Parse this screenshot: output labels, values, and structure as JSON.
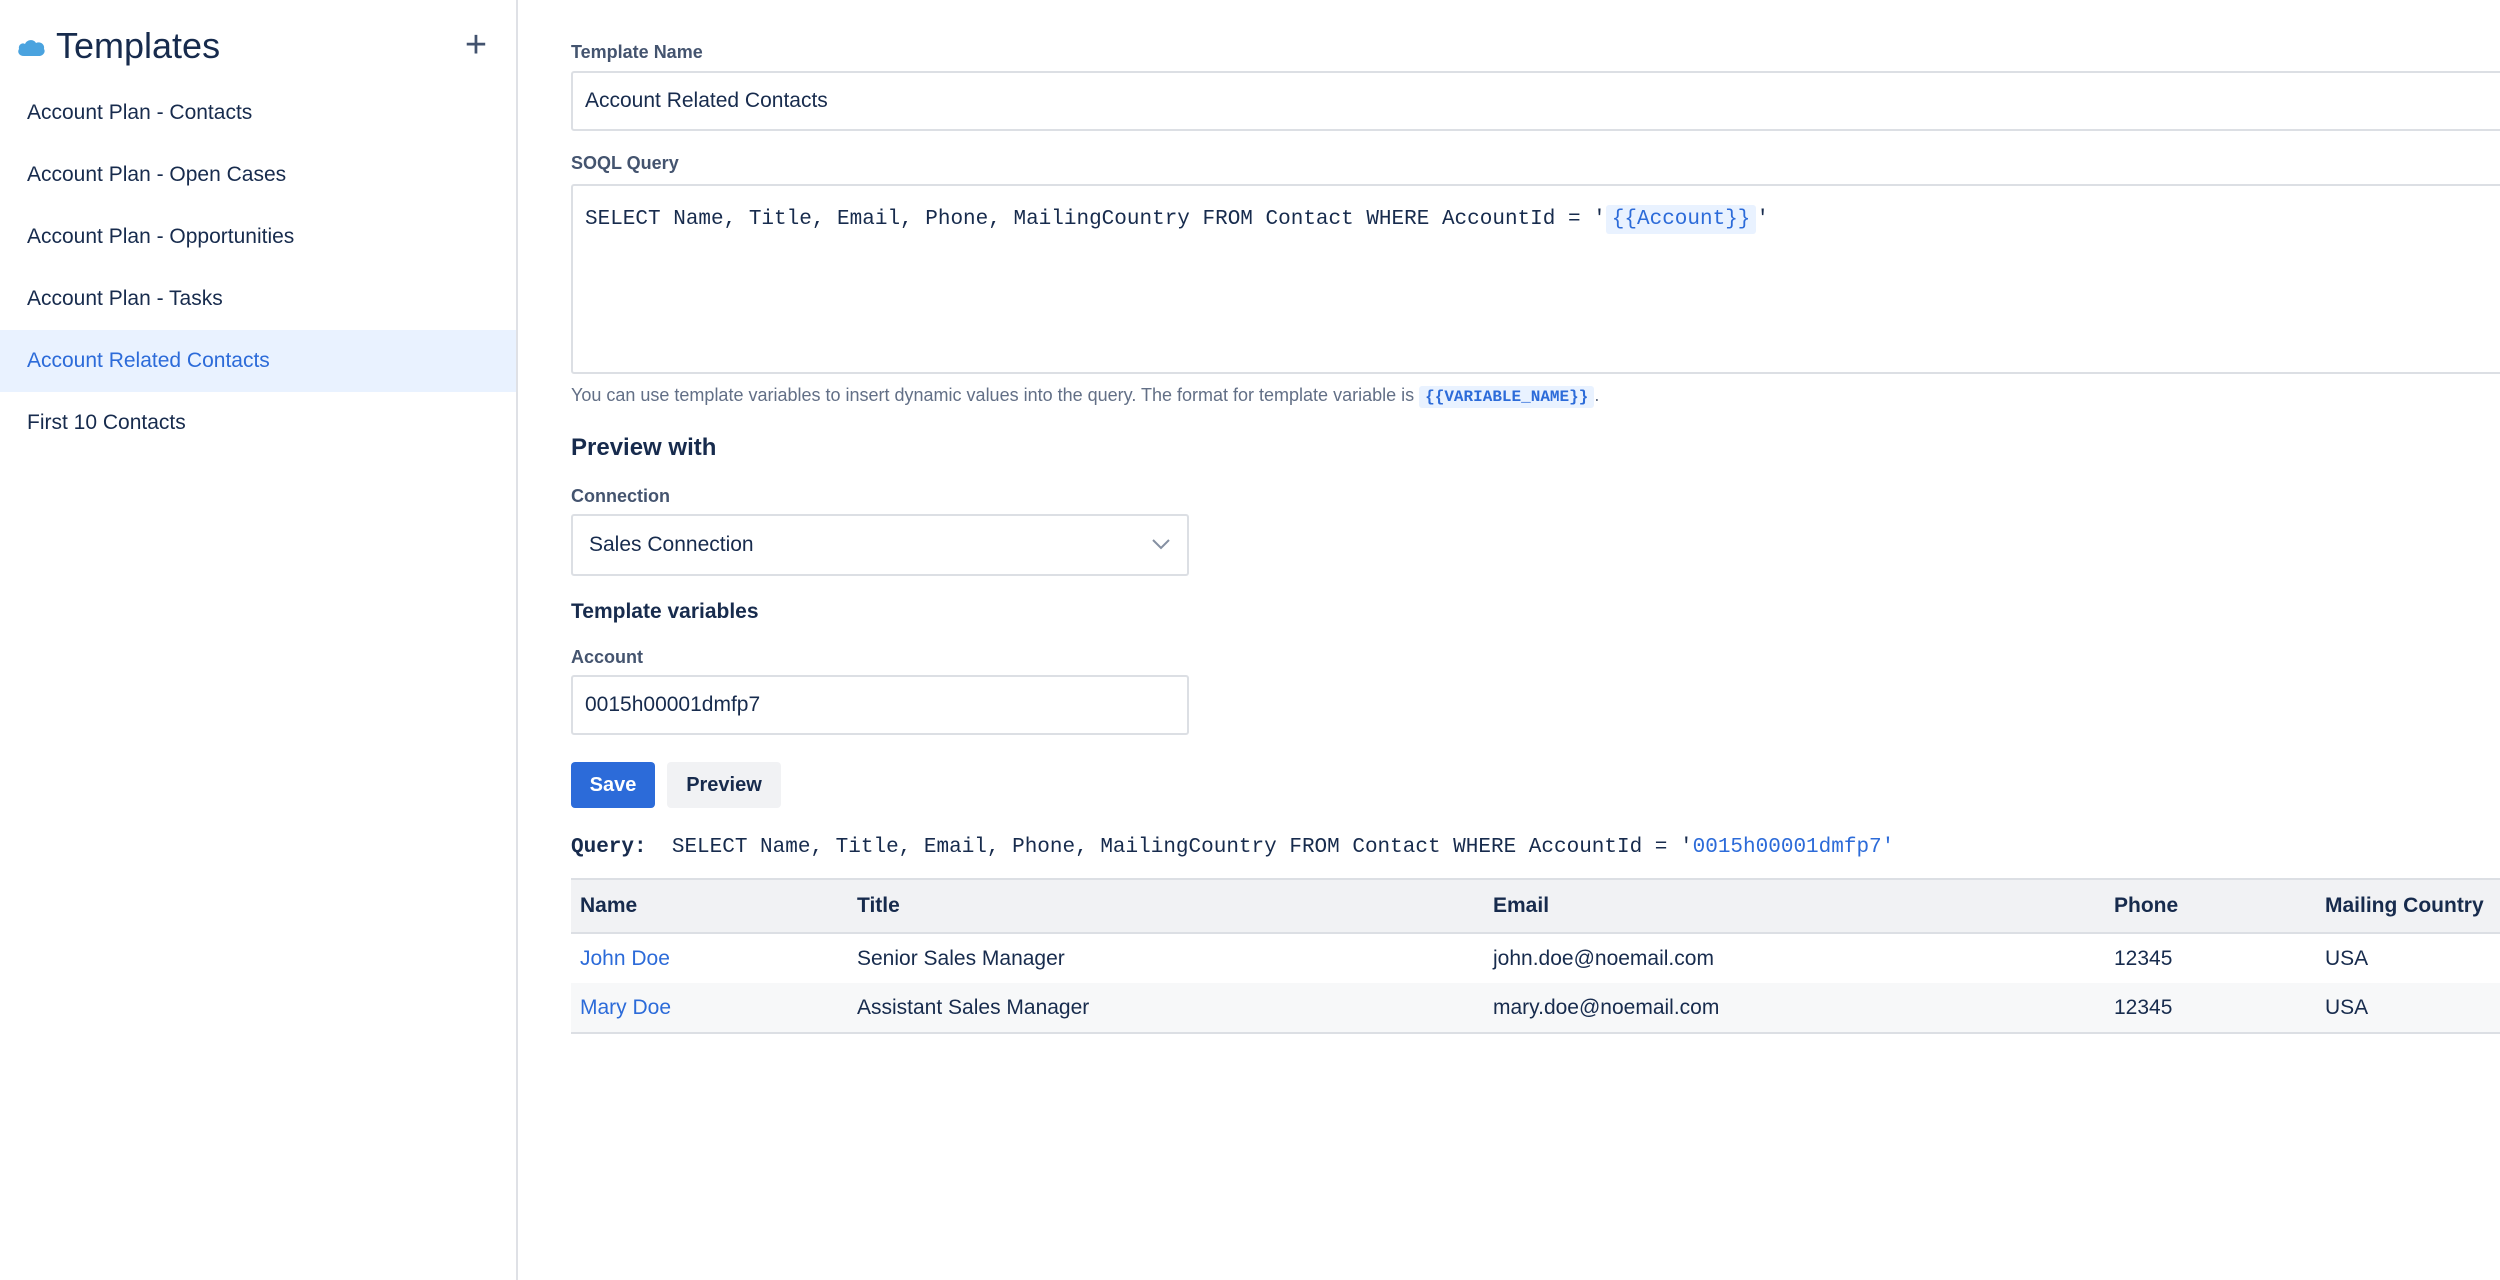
{
  "sidebar": {
    "title": "Templates",
    "add_icon": "plus-icon",
    "logo_icon": "cloud-logo-icon",
    "items": [
      {
        "label": "Account Plan - Contacts"
      },
      {
        "label": "Account Plan - Open Cases"
      },
      {
        "label": "Account Plan - Opportunities"
      },
      {
        "label": "Account Plan - Tasks"
      },
      {
        "label": "Account Related Contacts",
        "active": true
      },
      {
        "label": "First 10 Contacts"
      }
    ]
  },
  "form": {
    "template_name_label": "Template Name",
    "template_name_value": "Account Related Contacts",
    "soql_label": "SOQL Query",
    "soql_prefix": "SELECT Name, Title, Email, Phone, MailingCountry FROM Contact WHERE AccountId = '",
    "soql_variable": "{{Account}}",
    "soql_suffix": "'",
    "help_text": "You can use template variables to insert dynamic values into the query. The format for template variable is ",
    "help_code": "{{VARIABLE_NAME}}",
    "help_end": "."
  },
  "preview": {
    "heading": "Preview with",
    "connection_label": "Connection",
    "connection_value": "Sales Connection",
    "vars_heading": "Template variables",
    "account_label": "Account",
    "account_value": "0015h00001dmfp7",
    "save_label": "Save",
    "preview_label": "Preview"
  },
  "query": {
    "label": "Query:",
    "prefix": "SELECT Name, Title, Email, Phone, MailingCountry FROM Contact WHERE AccountId = '",
    "value": "0015h00001dmfp7",
    "suffix": "'"
  },
  "table": {
    "headers": [
      "Name",
      "Title",
      "Email",
      "Phone",
      "Mailing Country"
    ],
    "rows": [
      [
        "John Doe",
        "Senior Sales Manager",
        "john.doe@noemail.com",
        "12345",
        "USA"
      ],
      [
        "Mary Doe",
        "Assistant Sales Manager",
        "mary.doe@noemail.com",
        "12345",
        "USA"
      ]
    ]
  },
  "colors": {
    "accent": "#2c6bd9",
    "active_bg": "#e9f2ff",
    "text": "#172b4d",
    "border": "#dcdfe4"
  }
}
